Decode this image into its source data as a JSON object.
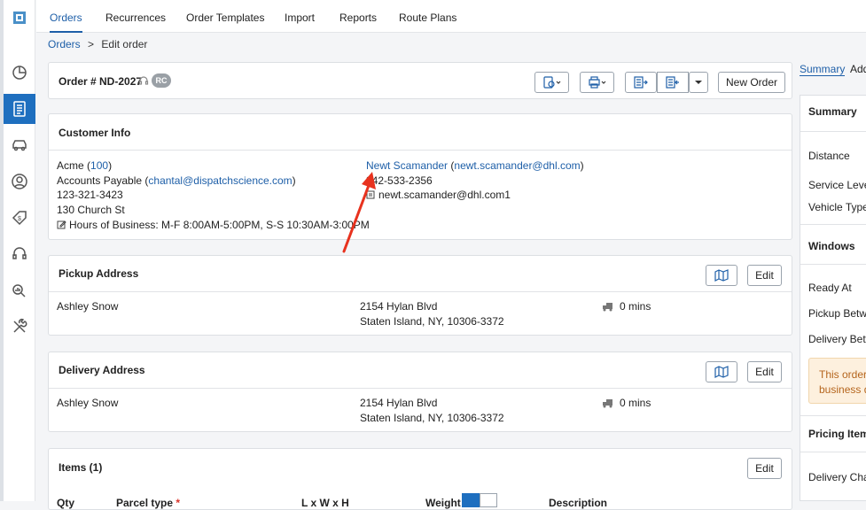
{
  "nav": {
    "tabs": [
      {
        "label": "Orders"
      },
      {
        "label": "Recurrences"
      },
      {
        "label": "Order Templates"
      },
      {
        "label": "Import"
      },
      {
        "label": "Reports"
      },
      {
        "label": "Route Plans"
      }
    ]
  },
  "breadcrumb": {
    "root": "Orders",
    "separator": ">",
    "current": "Edit order"
  },
  "order": {
    "title": "Order # ND-2027",
    "badge": "RC",
    "new_order_label": "New Order"
  },
  "customer": {
    "title": "Customer Info",
    "company": "Acme",
    "company_id": "100",
    "billing_name": "Accounts Payable",
    "billing_email": "chantal@dispatchscience.com",
    "phone": "123-321-3423",
    "address": "130 Church St",
    "hours": "Hours of Business: M-F 8:00AM-5:00PM, S-S 10:30AM-3:00PM",
    "contact_name": "Newt Scamander",
    "contact_email": "newt.scamander@dhl.com",
    "contact_phone": "342-533-2356",
    "contact_alt_email": "newt.scamander@dhl.com1"
  },
  "pickup": {
    "title": "Pickup Address",
    "name": "Ashley Snow",
    "street": "2154 Hylan Blvd",
    "city": "Staten Island, NY, 10306-3372",
    "wait": "0 mins",
    "edit_label": "Edit"
  },
  "delivery": {
    "title": "Delivery Address",
    "name": "Ashley Snow",
    "street": "2154 Hylan Blvd",
    "city": "Staten Island, NY, 10306-3372",
    "wait": "0 mins",
    "edit_label": "Edit"
  },
  "items": {
    "title": "Items (1)",
    "edit_label": "Edit",
    "columns": [
      "Qty",
      "Parcel type",
      "L x W x H",
      "Weight",
      "Description"
    ],
    "required_mark": "*"
  },
  "right_panel": {
    "tabs": [
      "Summary",
      "Add"
    ],
    "summary_title": "Summary",
    "distance": "Distance",
    "service_level": "Service Level",
    "vehicle_type": "Vehicle Type",
    "windows_title": "Windows",
    "ready_at": "Ready At",
    "pickup_between": "Pickup Betwe",
    "delivery_between": "Delivery Betw",
    "notice_line1": "This order",
    "notice_line2": "business da",
    "pricing_title": "Pricing Items",
    "delivery_charge": "Delivery Char"
  },
  "colors": {
    "accent": "#1e5fa8",
    "annotation_arrow": "#e8321e",
    "notice_bg": "#fdf0de"
  }
}
